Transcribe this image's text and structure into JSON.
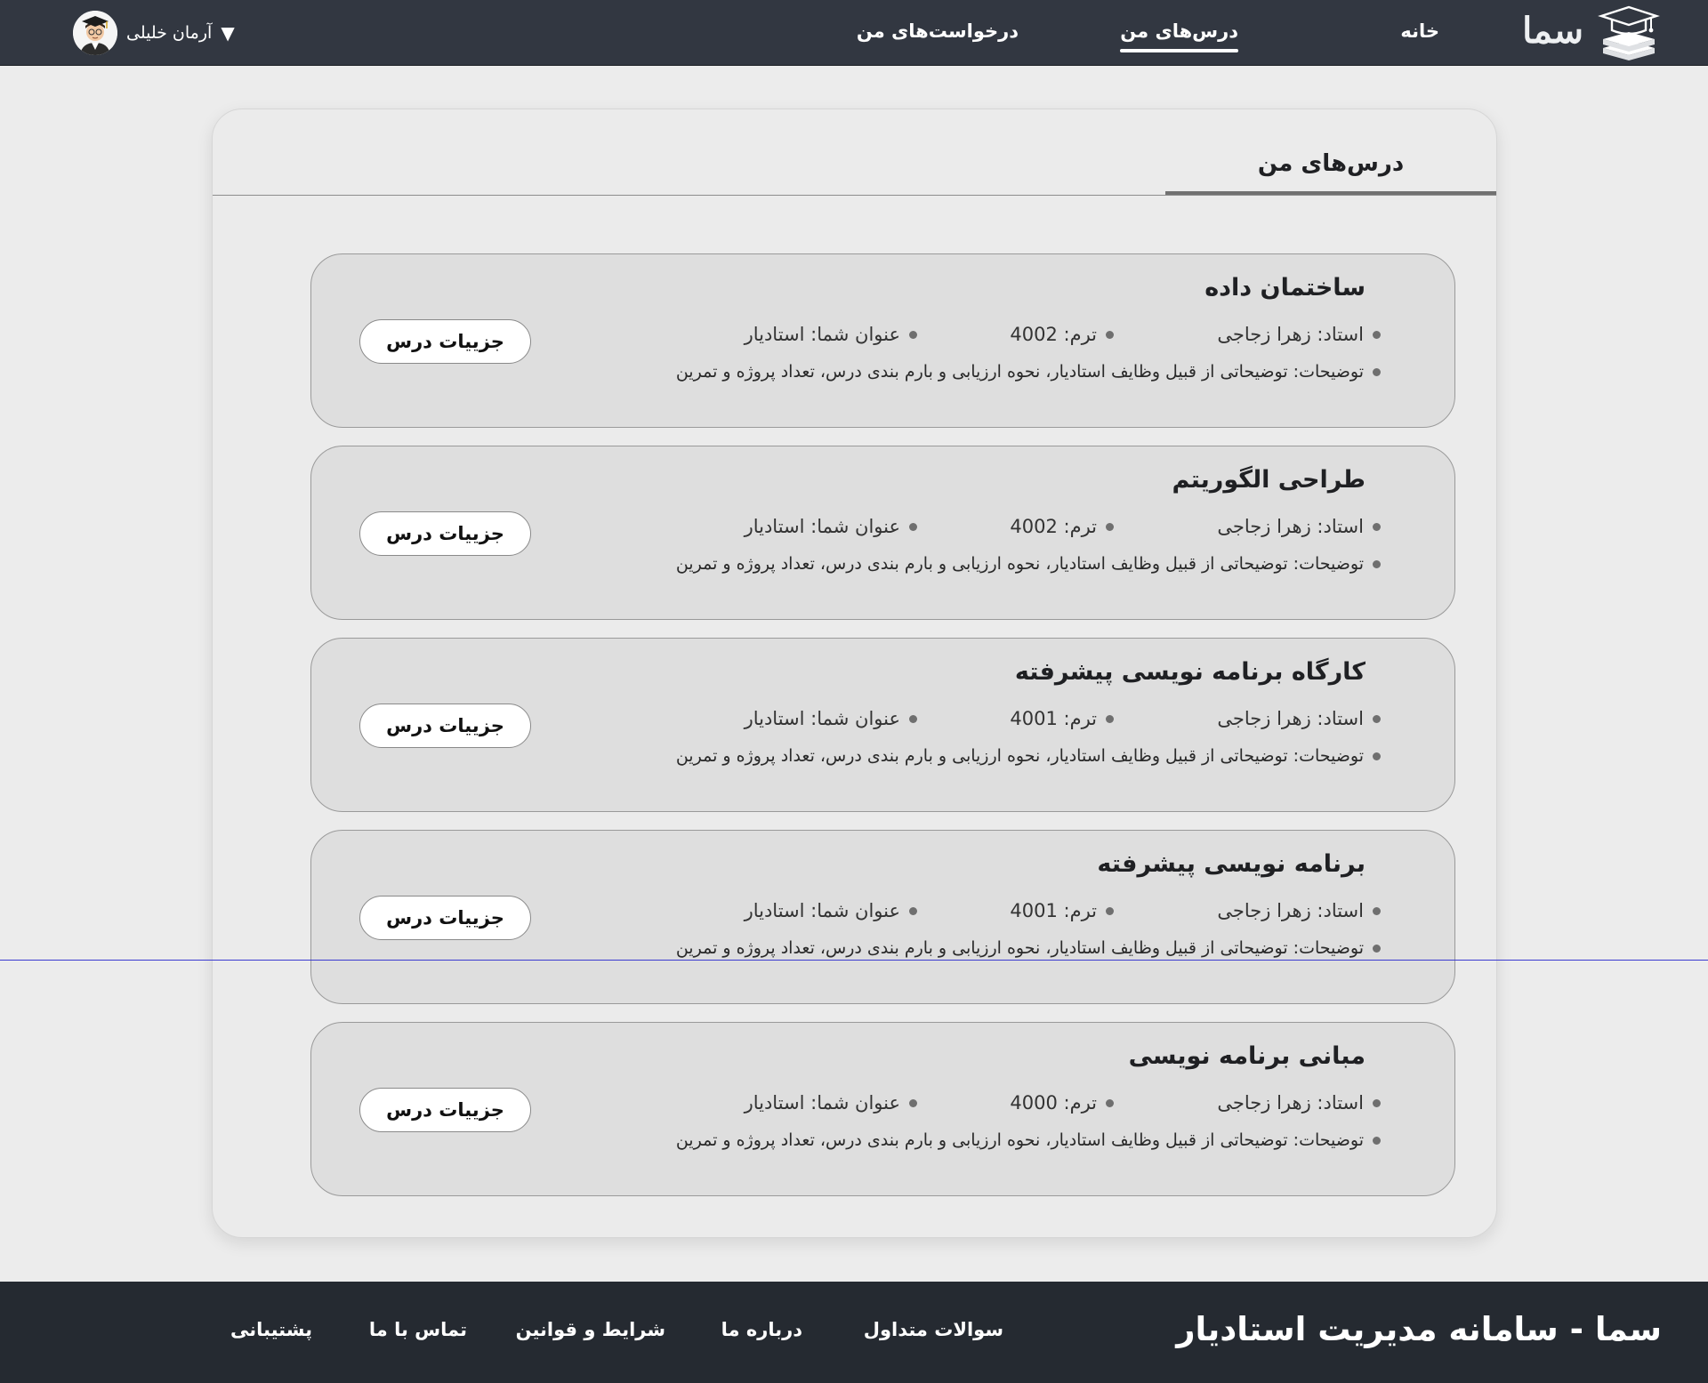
{
  "header": {
    "brand": "سما",
    "nav": [
      {
        "label": "خانه",
        "active": false
      },
      {
        "label": "درس‌های من",
        "active": true
      },
      {
        "label": "درخواست‌های من",
        "active": false
      }
    ],
    "user": {
      "name": "آرمان خلیلی",
      "caret": "▼"
    }
  },
  "panel": {
    "tab": "درس‌های من"
  },
  "courses": [
    {
      "title": "ساختمان داده",
      "instructor": "استاد: زهرا زجاجی",
      "term": "ترم: 4002",
      "role": "عنوان شما: استادیار",
      "description": "توضیحات: توضیحاتی از قبیل وظایف استادیار، نحوه ارزیابی و بارم بندی درس، تعداد پروژه و تمرین",
      "button": "جزییات درس"
    },
    {
      "title": "طراحی الگوریتم",
      "instructor": "استاد: زهرا زجاجی",
      "term": "ترم: 4002",
      "role": "عنوان شما: استادیار",
      "description": "توضیحات: توضیحاتی از قبیل وظایف استادیار، نحوه ارزیابی و بارم بندی درس، تعداد پروژه و تمرین",
      "button": "جزییات درس"
    },
    {
      "title": "کارگاه برنامه نویسی پیشرفته",
      "instructor": "استاد: زهرا زجاجی",
      "term": "ترم: 4001",
      "role": "عنوان شما: استادیار",
      "description": "توضیحات: توضیحاتی از قبیل وظایف استادیار، نحوه ارزیابی و بارم بندی درس، تعداد پروژه و تمرین",
      "button": "جزییات درس"
    },
    {
      "title": "برنامه نویسی پیشرفته",
      "instructor": "استاد: زهرا زجاجی",
      "term": "ترم: 4001",
      "role": "عنوان شما: استادیار",
      "description": "توضیحات: توضیحاتی از قبیل وظایف استادیار، نحوه ارزیابی و بارم بندی درس، تعداد پروژه و تمرین",
      "button": "جزییات درس"
    },
    {
      "title": "مبانی برنامه نویسی",
      "instructor": "استاد: زهرا زجاجی",
      "term": "ترم: 4000",
      "role": "عنوان شما: استادیار",
      "description": "توضیحات: توضیحاتی از قبیل وظایف استادیار، نحوه ارزیابی و بارم بندی درس، تعداد پروژه و تمرین",
      "button": "جزییات درس"
    }
  ],
  "footer": {
    "title": "سما - سامانه مدیریت استادیار",
    "links": [
      "سوالات متداول",
      "درباره ما",
      "شرایط و قوانین",
      "تماس با ما",
      "پشتیبانی"
    ]
  },
  "colors": {
    "header_bg": "#323741",
    "footer_bg": "#252a31",
    "page_bg": "#ececec",
    "card_bg": "#dedede"
  },
  "icons": {
    "logo": "graduation-cap-books-icon",
    "bullet": "dot-icon",
    "avatar": "student-avatar"
  }
}
